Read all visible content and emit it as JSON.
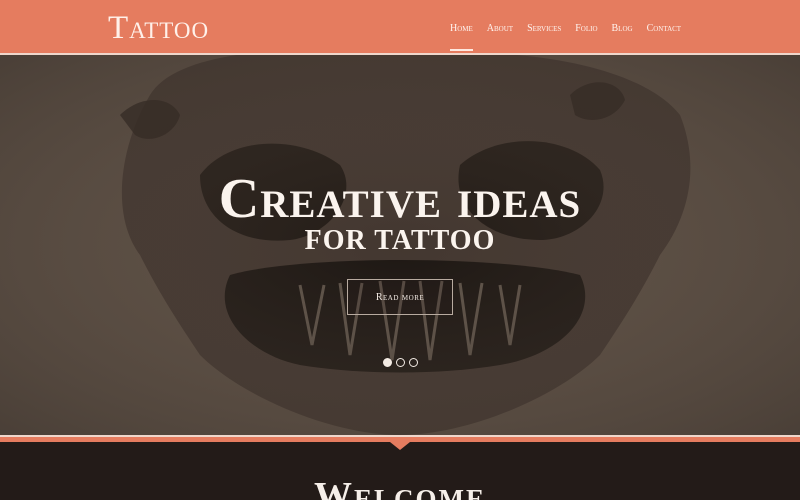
{
  "header": {
    "logo": "Tattoo",
    "nav": [
      "Home",
      "About",
      "Services",
      "Folio",
      "Blog",
      "Contact"
    ],
    "active_index": 0
  },
  "hero": {
    "title": "Creative ideas",
    "subtitle": "FOR TATTOO",
    "button_label": "Read more",
    "slides_total": 3,
    "active_slide": 1
  },
  "welcome": {
    "heading": "Welcome"
  },
  "colors": {
    "accent": "#e57c5f",
    "dark": "#231b18",
    "hero_bg": "#5a4d42"
  }
}
